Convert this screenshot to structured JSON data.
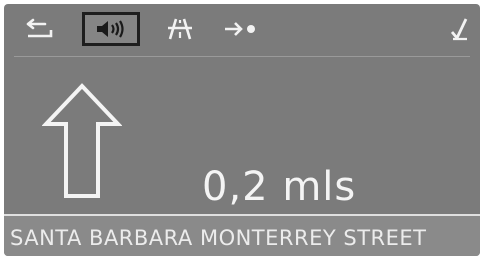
{
  "toolbar": {
    "items": [
      {
        "icon": "back-icon",
        "selected": false
      },
      {
        "icon": "speaker-icon",
        "selected": true
      },
      {
        "icon": "highway-icon",
        "selected": false
      },
      {
        "icon": "route-guidance-icon",
        "selected": false
      },
      {
        "icon": "checkmark-icon",
        "selected": false
      }
    ]
  },
  "guidance": {
    "direction_icon": "straight-arrow-icon",
    "distance": "0,2 mls"
  },
  "street": {
    "name": "SANTA BARBARA MONTERREY STREET"
  },
  "colors": {
    "screen": "#7b7b7b",
    "text": "#f4f4f4",
    "selection_frame": "#1e1e1e"
  }
}
